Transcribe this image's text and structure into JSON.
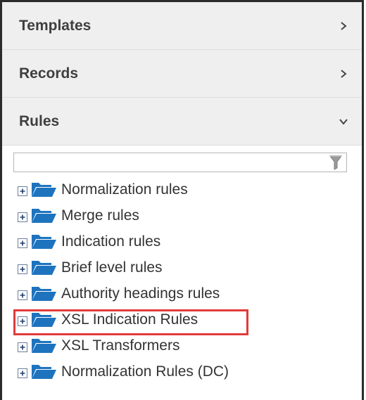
{
  "sections": [
    {
      "label": "Templates",
      "state": "collapsed",
      "chevron_icon": "chevron-right-icon"
    },
    {
      "label": "Records",
      "state": "collapsed",
      "chevron_icon": "chevron-right-icon"
    },
    {
      "label": "Rules",
      "state": "expanded",
      "chevron_icon": "chevron-down-icon"
    }
  ],
  "filter": {
    "value": "",
    "icon": "funnel-filter-icon"
  },
  "tree": [
    {
      "label": "Normalization rules"
    },
    {
      "label": "Merge rules"
    },
    {
      "label": "Indication rules"
    },
    {
      "label": "Brief level rules"
    },
    {
      "label": "Authority headings rules"
    },
    {
      "label": "XSL Indication Rules",
      "highlighted": true
    },
    {
      "label": "XSL Transformers"
    },
    {
      "label": "Normalization Rules (DC)"
    }
  ],
  "colors": {
    "folder": "#1e73be",
    "highlight": "#e23a3a",
    "header_bg": "#efefef"
  }
}
